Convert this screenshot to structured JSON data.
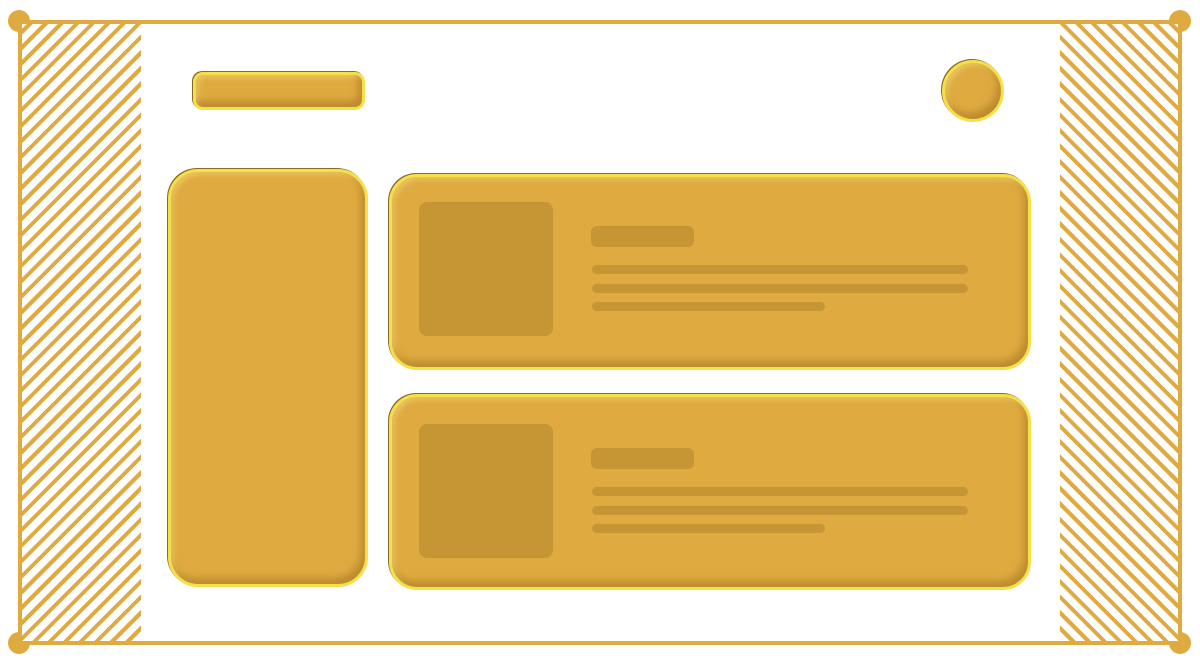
{
  "colors": {
    "accent": "#dfab41",
    "highlight": "#f6e04a",
    "placeholder": "#c69534",
    "background": "#ffffff"
  },
  "layout_regions": [
    "header-logo",
    "avatar",
    "sidebar",
    "content-card",
    "content-card"
  ]
}
